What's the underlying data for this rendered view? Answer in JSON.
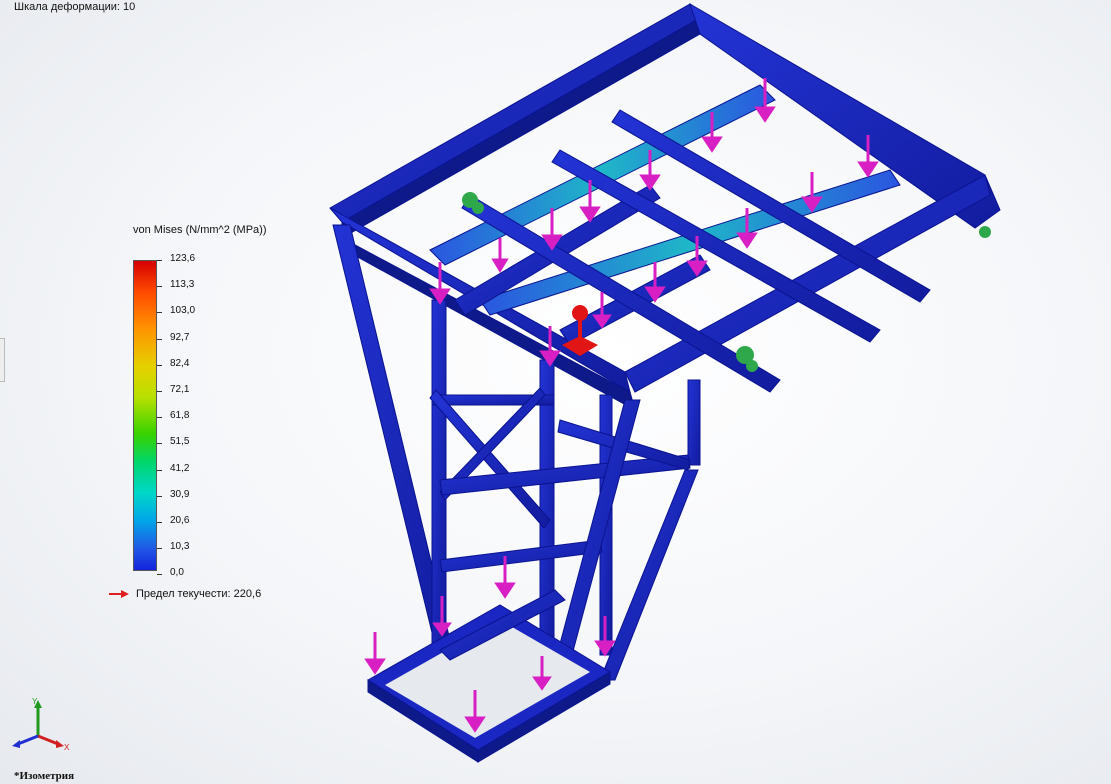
{
  "deformation_scale": "Шкала деформации: 10",
  "legend": {
    "title": "von Mises (N/mm^2 (MPa))",
    "ticks": [
      "123,6",
      "113,3",
      "103,0",
      "92,7",
      "82,4",
      "72,1",
      "61,8",
      "51,5",
      "41,2",
      "30,9",
      "20,6",
      "10,3",
      "0,0"
    ]
  },
  "yield_strength": "Предел текучести: 220,6",
  "view_name": "*Изометрия",
  "triad": {
    "y": "Y",
    "x": "X"
  },
  "colors": {
    "frame": "#1c28c8",
    "frame_edge": "#0a1390",
    "load_arrow": "#d81fc4",
    "fixture": "#2ea84a",
    "marker": "#e11515"
  }
}
